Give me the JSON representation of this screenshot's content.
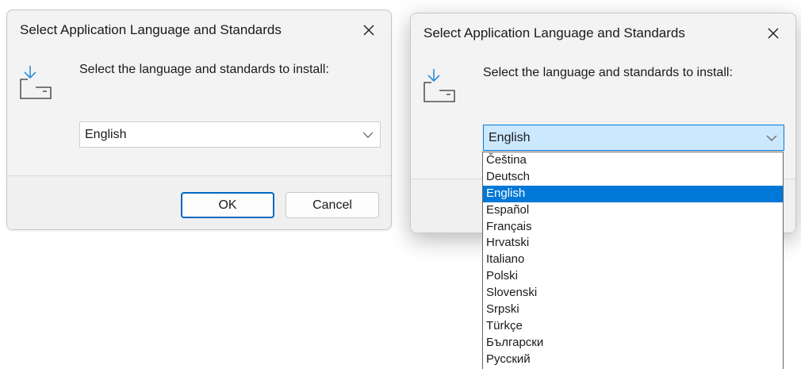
{
  "dialog": {
    "title": "Select Application Language and Standards",
    "prompt": "Select the language and standards to install:",
    "selected_language": "English",
    "ok_label": "OK",
    "cancel_label": "Cancel",
    "icons": {
      "close": "close-icon",
      "install": "install-download-icon",
      "chevron": "chevron-down-icon"
    }
  },
  "dropdown": {
    "options": [
      "Čeština",
      "Deutsch",
      "English",
      "Español",
      "Français",
      "Hrvatski",
      "Italiano",
      "Polski",
      "Slovenski",
      "Srpski",
      "Türkçe",
      "Български",
      "Русский"
    ],
    "highlighted": "English",
    "highlight_color": "#0078d7"
  },
  "colors": {
    "dialog_background": "#f3f3f3",
    "accent": "#0067c0",
    "combo_active": "#cce8ff"
  }
}
